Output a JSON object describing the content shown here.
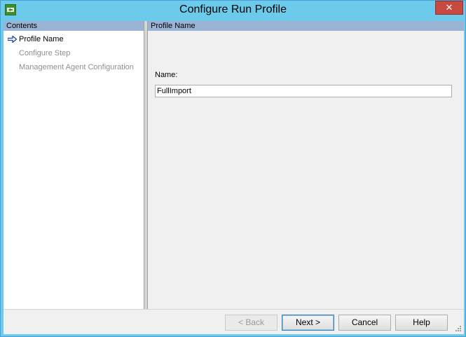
{
  "window": {
    "title": "Configure Run Profile",
    "close_label": "✕"
  },
  "contents": {
    "header": "Contents",
    "items": [
      {
        "label": "Profile Name",
        "state": "active"
      },
      {
        "label": "Configure Step",
        "state": "disabled"
      },
      {
        "label": "Management Agent Configuration",
        "state": "disabled"
      }
    ]
  },
  "profile_name": {
    "header": "Profile Name",
    "name_label": "Name:",
    "name_value": "FullImport"
  },
  "footer": {
    "back_label": "< Back",
    "next_label": "Next >",
    "cancel_label": "Cancel",
    "help_label": "Help"
  },
  "colors": {
    "titlebar": "#6ccbea",
    "pane_header": "#9ab3d4",
    "client": "#f0f0f0"
  }
}
